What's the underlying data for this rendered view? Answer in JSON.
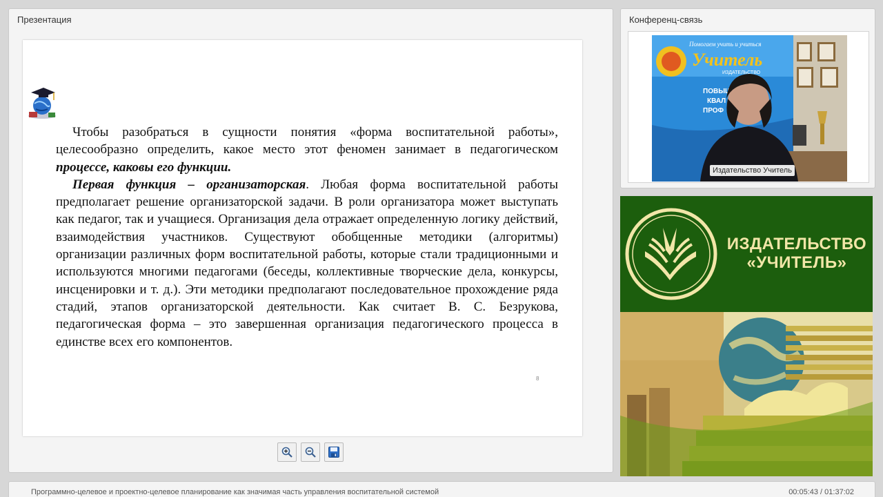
{
  "presentation": {
    "panel_title": "Презентация",
    "slide": {
      "paragraph1": {
        "text": "Чтобы разобраться в сущности понятия «форма воспитательной работы», целесообразно определить, какое место этот феномен занимает в педагогическом ",
        "emphasis": "процессе, каковы его функции."
      },
      "paragraph2": {
        "emphasis": "Первая функция – организаторская",
        "text": ". Любая форма воспитательной работы предполагает решение организаторской задачи. В роли организатора может выступать как педагог, так и учащиеся. Организация дела отражает определенную логику действий, взаимодействия участников. Существуют обобщенные методики (алгоритмы) организации различных форм воспитательной работы, которые стали традиционными и используются многими педагогами (беседы, коллективные творческие дела, конкурсы, инсценировки и т. д.). Эти методики предполагают последовательное прохождение ряда стадий, этапов организаторской деятельности. Как считает В. С. Безрукова, педагогическая форма – это завершенная организация педагогического процесса в единстве всех его компонентов."
      },
      "page_number": "8"
    },
    "toolbar": {
      "icons": [
        "zoom-in-icon",
        "zoom-out-icon",
        "save-icon"
      ]
    }
  },
  "conference": {
    "panel_title": "Конференц-связь",
    "video_label": "Издательство Учитель",
    "backdrop_banner": {
      "line1": "Помогаем учить и учиться",
      "line2": "Учитель",
      "line3": "ИЗДАТЕЛЬСТВО",
      "items": [
        "ПОВЫШЕН",
        "КВАЛ",
        "ПРОФ"
      ]
    }
  },
  "publisher_banner": {
    "title_line1": "ИЗДАТЕЛЬСТВО",
    "title_line2": "«УЧИТЕЛЬ»"
  },
  "footer": {
    "title": "Программно-целевое и проектно-целевое планирование как значимая часть управления воспитательной системой",
    "time": "00:05:43 / 01:37:02"
  },
  "colors": {
    "banner_green": "#1c5e0d",
    "banner_gold": "#f2e6a8"
  }
}
